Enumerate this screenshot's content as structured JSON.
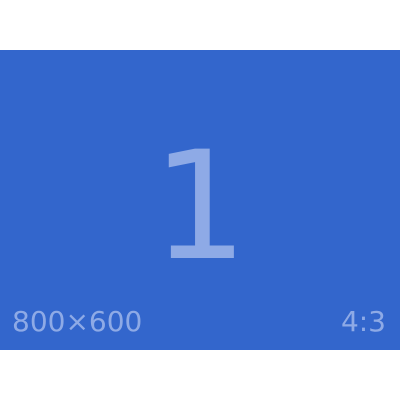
{
  "placeholder": {
    "number": "1",
    "dimensions": "800×600",
    "aspect_ratio": "4:3",
    "colors": {
      "background": "#3366cc",
      "text": "#8eaae6",
      "page": "#ffffff"
    }
  }
}
